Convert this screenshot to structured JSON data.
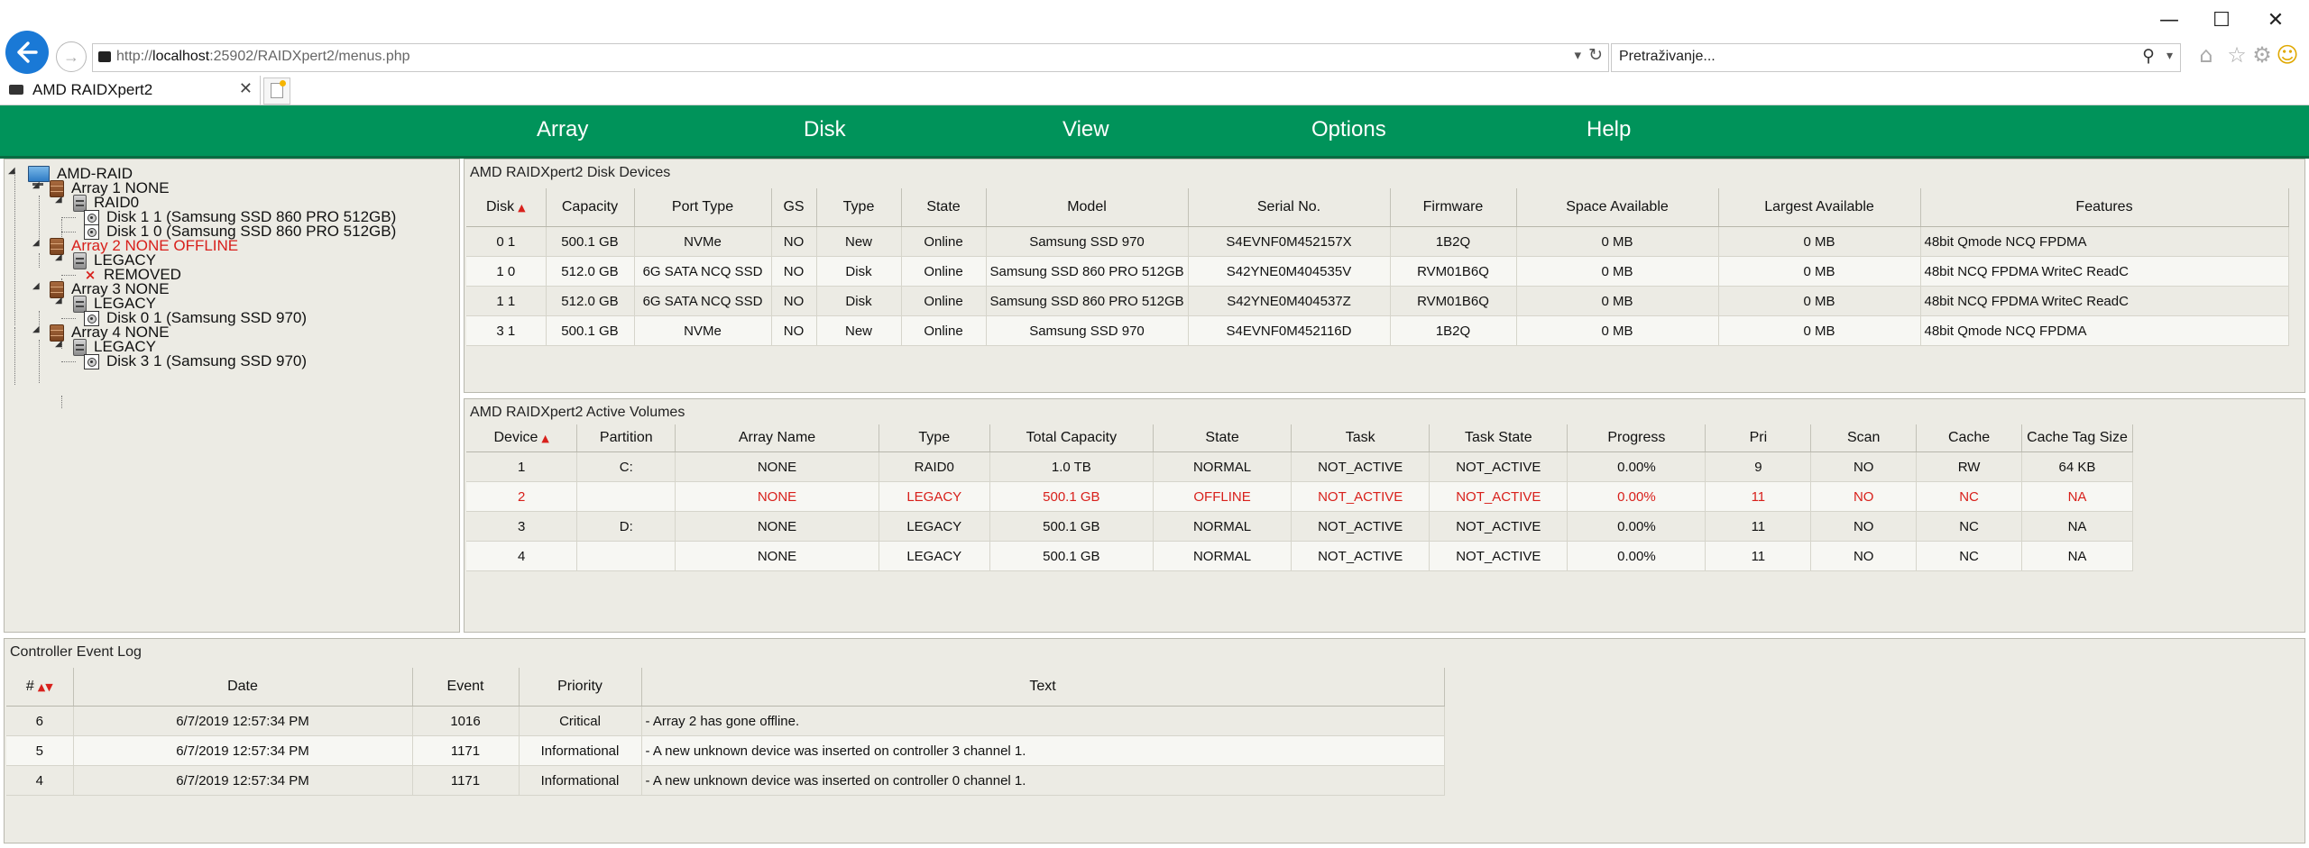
{
  "browser": {
    "url_prefix": "http://",
    "url_host": "localhost",
    "url_rest": ":25902/RAIDXpert2/menus.php",
    "search_placeholder": "Pretraživanje...",
    "tab_title": "AMD RAIDXpert2",
    "window_controls": {
      "minimize": "—",
      "maximize": "☐",
      "close": "✕"
    }
  },
  "menu": {
    "items": [
      "Array",
      "Disk",
      "View",
      "Options",
      "Help"
    ]
  },
  "tree": {
    "nodes": [
      {
        "label": "AMD-RAID",
        "icon": "controller-icon"
      },
      {
        "label": "Array 1 NONE",
        "icon": "array-icon"
      },
      {
        "label": "RAID0",
        "icon": "raid-volume-icon"
      },
      {
        "label": "Disk 1 1 (Samsung SSD 860 PRO 512GB)",
        "icon": "disk-icon"
      },
      {
        "label": "Disk 1 0 (Samsung SSD 860 PRO 512GB)",
        "icon": "disk-icon"
      },
      {
        "label": "Array 2 NONE OFFLINE",
        "icon": "array-icon",
        "status_color": "#d8201b"
      },
      {
        "label": "LEGACY",
        "icon": "raid-volume-icon"
      },
      {
        "label": "REMOVED",
        "icon": "removed-icon"
      },
      {
        "label": "Array 3 NONE",
        "icon": "array-icon"
      },
      {
        "label": "LEGACY",
        "icon": "raid-volume-icon"
      },
      {
        "label": "Disk 0 1 (Samsung SSD 970)",
        "icon": "disk-icon"
      },
      {
        "label": "Array 4 NONE",
        "icon": "array-icon"
      },
      {
        "label": "LEGACY",
        "icon": "raid-volume-icon"
      },
      {
        "label": "Disk 3 1 (Samsung SSD 970)",
        "icon": "disk-icon"
      }
    ]
  },
  "disk_devices": {
    "title": "AMD RAIDXpert2 Disk Devices",
    "columns": [
      "Disk",
      "Capacity",
      "Port Type",
      "GS",
      "Type",
      "State",
      "Model",
      "Serial No.",
      "Firmware",
      "Space Available",
      "Largest Available",
      "Features"
    ],
    "rows": [
      [
        "0 1",
        "500.1 GB",
        "NVMe",
        "NO",
        "New",
        "Online",
        "Samsung SSD 970",
        "S4EVNF0M452157X",
        "1B2Q",
        "0 MB",
        "0 MB",
        "48bit Qmode NCQ FPDMA"
      ],
      [
        "1 0",
        "512.0 GB",
        "6G SATA NCQ SSD",
        "NO",
        "Disk",
        "Online",
        "Samsung SSD 860 PRO 512GB",
        "S42YNE0M404535V",
        "RVM01B6Q",
        "0 MB",
        "0 MB",
        "48bit NCQ FPDMA WriteC ReadC"
      ],
      [
        "1 1",
        "512.0 GB",
        "6G SATA NCQ SSD",
        "NO",
        "Disk",
        "Online",
        "Samsung SSD 860 PRO 512GB",
        "S42YNE0M404537Z",
        "RVM01B6Q",
        "0 MB",
        "0 MB",
        "48bit NCQ FPDMA WriteC ReadC"
      ],
      [
        "3 1",
        "500.1 GB",
        "NVMe",
        "NO",
        "New",
        "Online",
        "Samsung SSD 970",
        "S4EVNF0M452116D",
        "1B2Q",
        "0 MB",
        "0 MB",
        "48bit Qmode NCQ FPDMA"
      ]
    ]
  },
  "active_volumes": {
    "title": "AMD RAIDXpert2 Active Volumes",
    "columns": [
      "Device",
      "Partition",
      "Array Name",
      "Type",
      "Total Capacity",
      "State",
      "Task",
      "Task State",
      "Progress",
      "Pri",
      "Scan",
      "Cache",
      "Cache Tag Size"
    ],
    "rows": [
      {
        "cells": [
          "1",
          "C:",
          "NONE",
          "RAID0",
          "1.0 TB",
          "NORMAL",
          "NOT_ACTIVE",
          "NOT_ACTIVE",
          "0.00%",
          "9",
          "NO",
          "RW",
          "64 KB"
        ],
        "error": false
      },
      {
        "cells": [
          "2",
          "",
          "NONE",
          "LEGACY",
          "500.1 GB",
          "OFFLINE",
          "NOT_ACTIVE",
          "NOT_ACTIVE",
          "0.00%",
          "11",
          "NO",
          "NC",
          "NA"
        ],
        "error": true
      },
      {
        "cells": [
          "3",
          "D:",
          "NONE",
          "LEGACY",
          "500.1 GB",
          "NORMAL",
          "NOT_ACTIVE",
          "NOT_ACTIVE",
          "0.00%",
          "11",
          "NO",
          "NC",
          "NA"
        ],
        "error": false
      },
      {
        "cells": [
          "4",
          "",
          "NONE",
          "LEGACY",
          "500.1 GB",
          "NORMAL",
          "NOT_ACTIVE",
          "NOT_ACTIVE",
          "0.00%",
          "11",
          "NO",
          "NC",
          "NA"
        ],
        "error": false
      }
    ]
  },
  "event_log": {
    "title": "Controller Event Log",
    "columns": [
      "#",
      "Date",
      "Event",
      "Priority",
      "Text"
    ],
    "rows": [
      [
        "6",
        "6/7/2019 12:57:34 PM",
        "1016",
        "Critical",
        "- Array 2 has gone offline."
      ],
      [
        "5",
        "6/7/2019 12:57:34 PM",
        "1171",
        "Informational",
        "- A new unknown device was inserted on controller 3 channel 1."
      ],
      [
        "4",
        "6/7/2019 12:57:34 PM",
        "1171",
        "Informational",
        "- A new unknown device was inserted on controller 0 channel 1."
      ]
    ]
  },
  "colors": {
    "menu_green": "#00935a",
    "panel_bg": "#ecebe4",
    "error_red": "#d8201b",
    "back_button_blue": "#1a79d6"
  }
}
